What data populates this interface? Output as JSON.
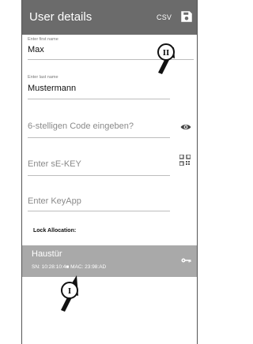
{
  "appbar": {
    "title": "User details",
    "csv_label": "CSV",
    "save_icon": "save-icon"
  },
  "form": {
    "first_name": {
      "label": "Enter first name",
      "value": "Max"
    },
    "last_name": {
      "label": "Enter last name",
      "value": "Mustermann"
    },
    "code": {
      "placeholder": "6-stelligen Code eingeben?",
      "icon": "eye-icon"
    },
    "sekey": {
      "placeholder": "Enter sE-KEY",
      "icon": "qr-code-icon"
    },
    "keyapp": {
      "placeholder": "Enter KeyApp"
    }
  },
  "lock_allocation": {
    "heading": "Lock Allocation:",
    "items": [
      {
        "name": "Haustür",
        "sn_mac": "SN: 10:28:10:4■ MAC: 23:98:AD",
        "icon": "key-icon"
      }
    ]
  },
  "callouts": [
    {
      "label": "II"
    },
    {
      "label": "I"
    }
  ],
  "colors": {
    "appbar": "#6b6b6b",
    "selected_row": "#a9a9a9"
  }
}
